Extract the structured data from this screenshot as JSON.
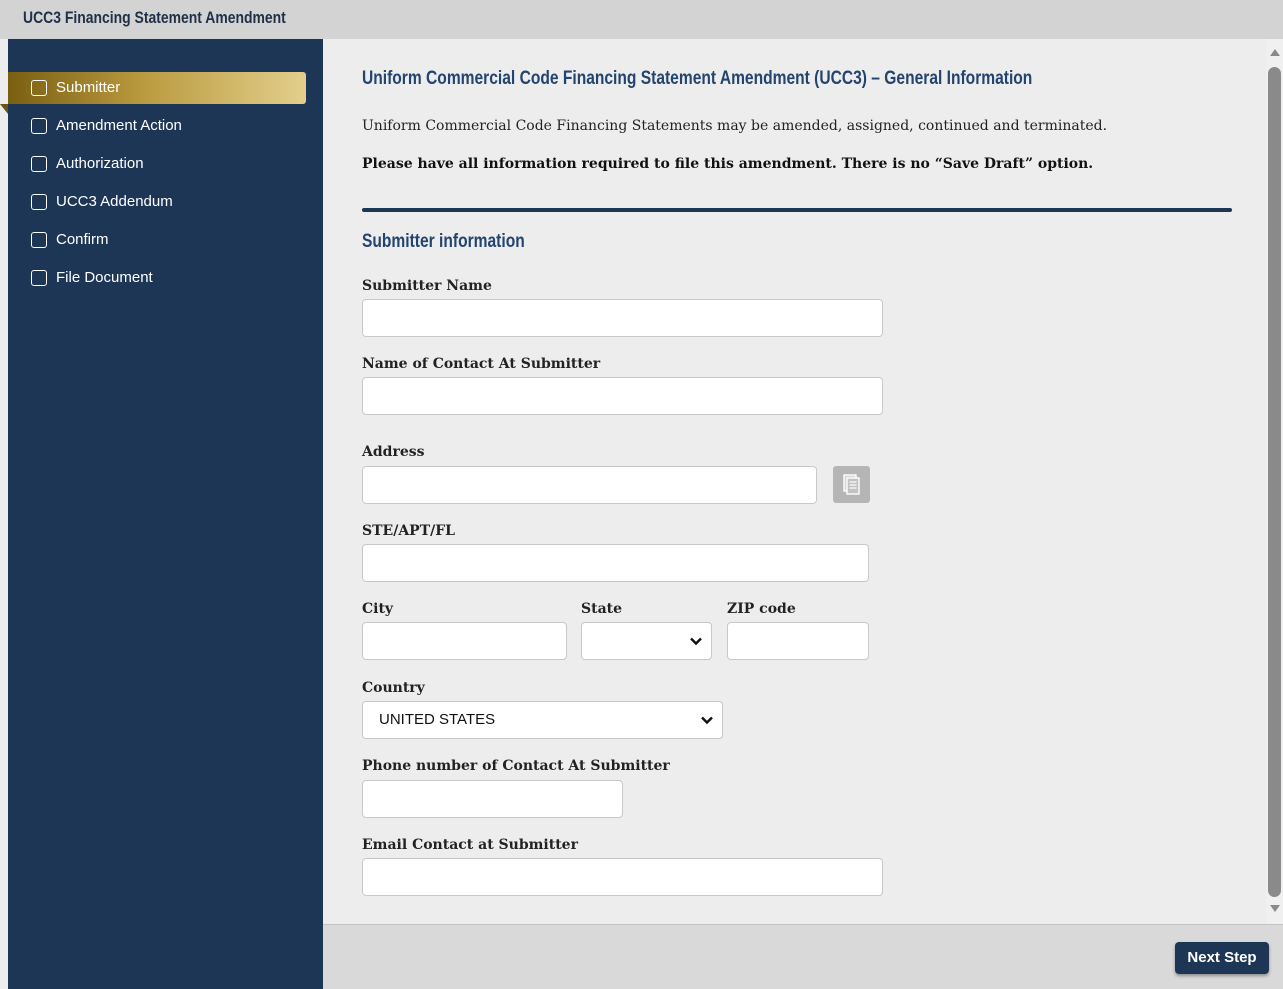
{
  "window": {
    "title": "UCC3 Financing Statement Amendment"
  },
  "sidebar": {
    "items": [
      {
        "label": "Submitter",
        "active": true
      },
      {
        "label": "Amendment Action",
        "active": false
      },
      {
        "label": "Authorization",
        "active": false
      },
      {
        "label": "UCC3 Addendum",
        "active": false
      },
      {
        "label": "Confirm",
        "active": false
      },
      {
        "label": "File Document",
        "active": false
      }
    ]
  },
  "main": {
    "heading": "Uniform Commercial Code Financing Statement Amendment (UCC3) – General Information",
    "intro": "Uniform Commercial Code Financing Statements may be amended, assigned, continued and terminated.",
    "warning": "Please have all information required to file this amendment. There is no “Save Draft” option.",
    "section_heading": "Submitter information"
  },
  "form": {
    "submitter_name": {
      "label": "Submitter Name",
      "value": ""
    },
    "contact_name": {
      "label": "Name of Contact At Submitter",
      "value": ""
    },
    "address": {
      "label": "Address",
      "value": ""
    },
    "suite": {
      "label": "STE/APT/FL",
      "value": ""
    },
    "city": {
      "label": "City",
      "value": ""
    },
    "state": {
      "label": "State",
      "value": ""
    },
    "zip": {
      "label": "ZIP code",
      "value": ""
    },
    "country": {
      "label": "Country",
      "value": "UNITED STATES"
    },
    "phone": {
      "label": "Phone number of Contact At Submitter",
      "value": ""
    },
    "email": {
      "label": "Email Contact at Submitter",
      "value": ""
    }
  },
  "footer": {
    "next_label": "Next Step"
  },
  "colors": {
    "sidebar_bg": "#1e3656",
    "active_gold": "#b99a3e",
    "heading_blue": "#23446e",
    "page_bg": "#ededed"
  },
  "icons": {
    "address_lookup": "document-icon",
    "select_arrow": "chevron-down-icon"
  }
}
